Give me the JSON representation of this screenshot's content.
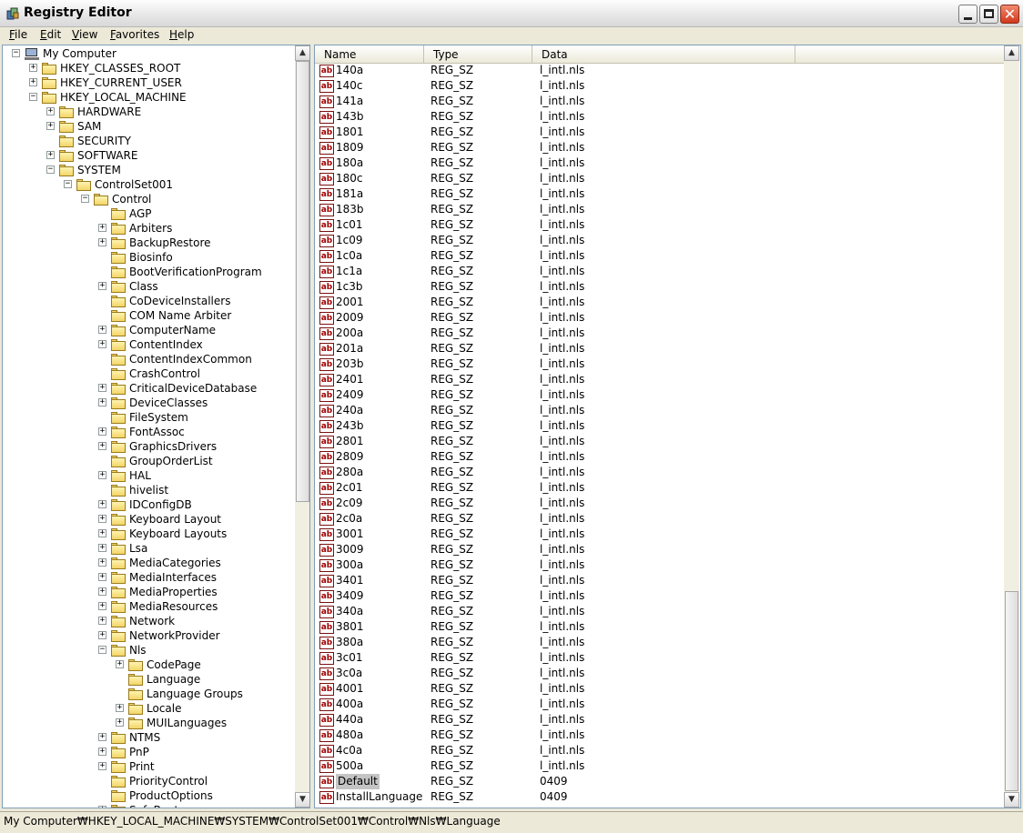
{
  "window": {
    "title": "Registry Editor"
  },
  "menu": [
    "File",
    "Edit",
    "View",
    "Favorites",
    "Help"
  ],
  "tree": [
    {
      "label": "My Computer",
      "depth": 0,
      "exp": "-",
      "icon": "computer"
    },
    {
      "label": "HKEY_CLASSES_ROOT",
      "depth": 1,
      "exp": "+"
    },
    {
      "label": "HKEY_CURRENT_USER",
      "depth": 1,
      "exp": "+"
    },
    {
      "label": "HKEY_LOCAL_MACHINE",
      "depth": 1,
      "exp": "-"
    },
    {
      "label": "HARDWARE",
      "depth": 2,
      "exp": "+"
    },
    {
      "label": "SAM",
      "depth": 2,
      "exp": "+"
    },
    {
      "label": "SECURITY",
      "depth": 2,
      "exp": ""
    },
    {
      "label": "SOFTWARE",
      "depth": 2,
      "exp": "+"
    },
    {
      "label": "SYSTEM",
      "depth": 2,
      "exp": "-"
    },
    {
      "label": "ControlSet001",
      "depth": 3,
      "exp": "-"
    },
    {
      "label": "Control",
      "depth": 4,
      "exp": "-"
    },
    {
      "label": "AGP",
      "depth": 5,
      "exp": ""
    },
    {
      "label": "Arbiters",
      "depth": 5,
      "exp": "+"
    },
    {
      "label": "BackupRestore",
      "depth": 5,
      "exp": "+"
    },
    {
      "label": "Biosinfo",
      "depth": 5,
      "exp": ""
    },
    {
      "label": "BootVerificationProgram",
      "depth": 5,
      "exp": ""
    },
    {
      "label": "Class",
      "depth": 5,
      "exp": "+"
    },
    {
      "label": "CoDeviceInstallers",
      "depth": 5,
      "exp": ""
    },
    {
      "label": "COM Name Arbiter",
      "depth": 5,
      "exp": ""
    },
    {
      "label": "ComputerName",
      "depth": 5,
      "exp": "+"
    },
    {
      "label": "ContentIndex",
      "depth": 5,
      "exp": "+"
    },
    {
      "label": "ContentIndexCommon",
      "depth": 5,
      "exp": ""
    },
    {
      "label": "CrashControl",
      "depth": 5,
      "exp": ""
    },
    {
      "label": "CriticalDeviceDatabase",
      "depth": 5,
      "exp": "+"
    },
    {
      "label": "DeviceClasses",
      "depth": 5,
      "exp": "+"
    },
    {
      "label": "FileSystem",
      "depth": 5,
      "exp": ""
    },
    {
      "label": "FontAssoc",
      "depth": 5,
      "exp": "+"
    },
    {
      "label": "GraphicsDrivers",
      "depth": 5,
      "exp": "+"
    },
    {
      "label": "GroupOrderList",
      "depth": 5,
      "exp": ""
    },
    {
      "label": "HAL",
      "depth": 5,
      "exp": "+"
    },
    {
      "label": "hivelist",
      "depth": 5,
      "exp": ""
    },
    {
      "label": "IDConfigDB",
      "depth": 5,
      "exp": "+"
    },
    {
      "label": "Keyboard Layout",
      "depth": 5,
      "exp": "+"
    },
    {
      "label": "Keyboard Layouts",
      "depth": 5,
      "exp": "+"
    },
    {
      "label": "Lsa",
      "depth": 5,
      "exp": "+"
    },
    {
      "label": "MediaCategories",
      "depth": 5,
      "exp": "+"
    },
    {
      "label": "MediaInterfaces",
      "depth": 5,
      "exp": "+"
    },
    {
      "label": "MediaProperties",
      "depth": 5,
      "exp": "+"
    },
    {
      "label": "MediaResources",
      "depth": 5,
      "exp": "+"
    },
    {
      "label": "Network",
      "depth": 5,
      "exp": "+"
    },
    {
      "label": "NetworkProvider",
      "depth": 5,
      "exp": "+"
    },
    {
      "label": "Nls",
      "depth": 5,
      "exp": "-"
    },
    {
      "label": "CodePage",
      "depth": 6,
      "exp": "+"
    },
    {
      "label": "Language",
      "depth": 6,
      "exp": "",
      "open": true
    },
    {
      "label": "Language Groups",
      "depth": 6,
      "exp": ""
    },
    {
      "label": "Locale",
      "depth": 6,
      "exp": "+"
    },
    {
      "label": "MUILanguages",
      "depth": 6,
      "exp": "+"
    },
    {
      "label": "NTMS",
      "depth": 5,
      "exp": "+"
    },
    {
      "label": "PnP",
      "depth": 5,
      "exp": "+"
    },
    {
      "label": "Print",
      "depth": 5,
      "exp": "+"
    },
    {
      "label": "PriorityControl",
      "depth": 5,
      "exp": ""
    },
    {
      "label": "ProductOptions",
      "depth": 5,
      "exp": ""
    },
    {
      "label": "SafeBoot",
      "depth": 5,
      "exp": "+"
    }
  ],
  "list_columns": [
    "Name",
    "Type",
    "Data"
  ],
  "list_rows": [
    [
      "140a",
      "REG_SZ",
      "l_intl.nls"
    ],
    [
      "140c",
      "REG_SZ",
      "l_intl.nls"
    ],
    [
      "141a",
      "REG_SZ",
      "l_intl.nls"
    ],
    [
      "143b",
      "REG_SZ",
      "l_intl.nls"
    ],
    [
      "1801",
      "REG_SZ",
      "l_intl.nls"
    ],
    [
      "1809",
      "REG_SZ",
      "l_intl.nls"
    ],
    [
      "180a",
      "REG_SZ",
      "l_intl.nls"
    ],
    [
      "180c",
      "REG_SZ",
      "l_intl.nls"
    ],
    [
      "181a",
      "REG_SZ",
      "l_intl.nls"
    ],
    [
      "183b",
      "REG_SZ",
      "l_intl.nls"
    ],
    [
      "1c01",
      "REG_SZ",
      "l_intl.nls"
    ],
    [
      "1c09",
      "REG_SZ",
      "l_intl.nls"
    ],
    [
      "1c0a",
      "REG_SZ",
      "l_intl.nls"
    ],
    [
      "1c1a",
      "REG_SZ",
      "l_intl.nls"
    ],
    [
      "1c3b",
      "REG_SZ",
      "l_intl.nls"
    ],
    [
      "2001",
      "REG_SZ",
      "l_intl.nls"
    ],
    [
      "2009",
      "REG_SZ",
      "l_intl.nls"
    ],
    [
      "200a",
      "REG_SZ",
      "l_intl.nls"
    ],
    [
      "201a",
      "REG_SZ",
      "l_intl.nls"
    ],
    [
      "203b",
      "REG_SZ",
      "l_intl.nls"
    ],
    [
      "2401",
      "REG_SZ",
      "l_intl.nls"
    ],
    [
      "2409",
      "REG_SZ",
      "l_intl.nls"
    ],
    [
      "240a",
      "REG_SZ",
      "l_intl.nls"
    ],
    [
      "243b",
      "REG_SZ",
      "l_intl.nls"
    ],
    [
      "2801",
      "REG_SZ",
      "l_intl.nls"
    ],
    [
      "2809",
      "REG_SZ",
      "l_intl.nls"
    ],
    [
      "280a",
      "REG_SZ",
      "l_intl.nls"
    ],
    [
      "2c01",
      "REG_SZ",
      "l_intl.nls"
    ],
    [
      "2c09",
      "REG_SZ",
      "l_intl.nls"
    ],
    [
      "2c0a",
      "REG_SZ",
      "l_intl.nls"
    ],
    [
      "3001",
      "REG_SZ",
      "l_intl.nls"
    ],
    [
      "3009",
      "REG_SZ",
      "l_intl.nls"
    ],
    [
      "300a",
      "REG_SZ",
      "l_intl.nls"
    ],
    [
      "3401",
      "REG_SZ",
      "l_intl.nls"
    ],
    [
      "3409",
      "REG_SZ",
      "l_intl.nls"
    ],
    [
      "340a",
      "REG_SZ",
      "l_intl.nls"
    ],
    [
      "3801",
      "REG_SZ",
      "l_intl.nls"
    ],
    [
      "380a",
      "REG_SZ",
      "l_intl.nls"
    ],
    [
      "3c01",
      "REG_SZ",
      "l_intl.nls"
    ],
    [
      "3c0a",
      "REG_SZ",
      "l_intl.nls"
    ],
    [
      "4001",
      "REG_SZ",
      "l_intl.nls"
    ],
    [
      "400a",
      "REG_SZ",
      "l_intl.nls"
    ],
    [
      "440a",
      "REG_SZ",
      "l_intl.nls"
    ],
    [
      "480a",
      "REG_SZ",
      "l_intl.nls"
    ],
    [
      "4c0a",
      "REG_SZ",
      "l_intl.nls"
    ],
    [
      "500a",
      "REG_SZ",
      "l_intl.nls"
    ],
    [
      "Default",
      "REG_SZ",
      "0409"
    ],
    [
      "InstallLanguage",
      "REG_SZ",
      "0409"
    ]
  ],
  "selected_value": "Default",
  "value_icon": "ab",
  "status": "My Computer₩HKEY_LOCAL_MACHINE₩SYSTEM₩ControlSet001₩Control₩Nls₩Language"
}
